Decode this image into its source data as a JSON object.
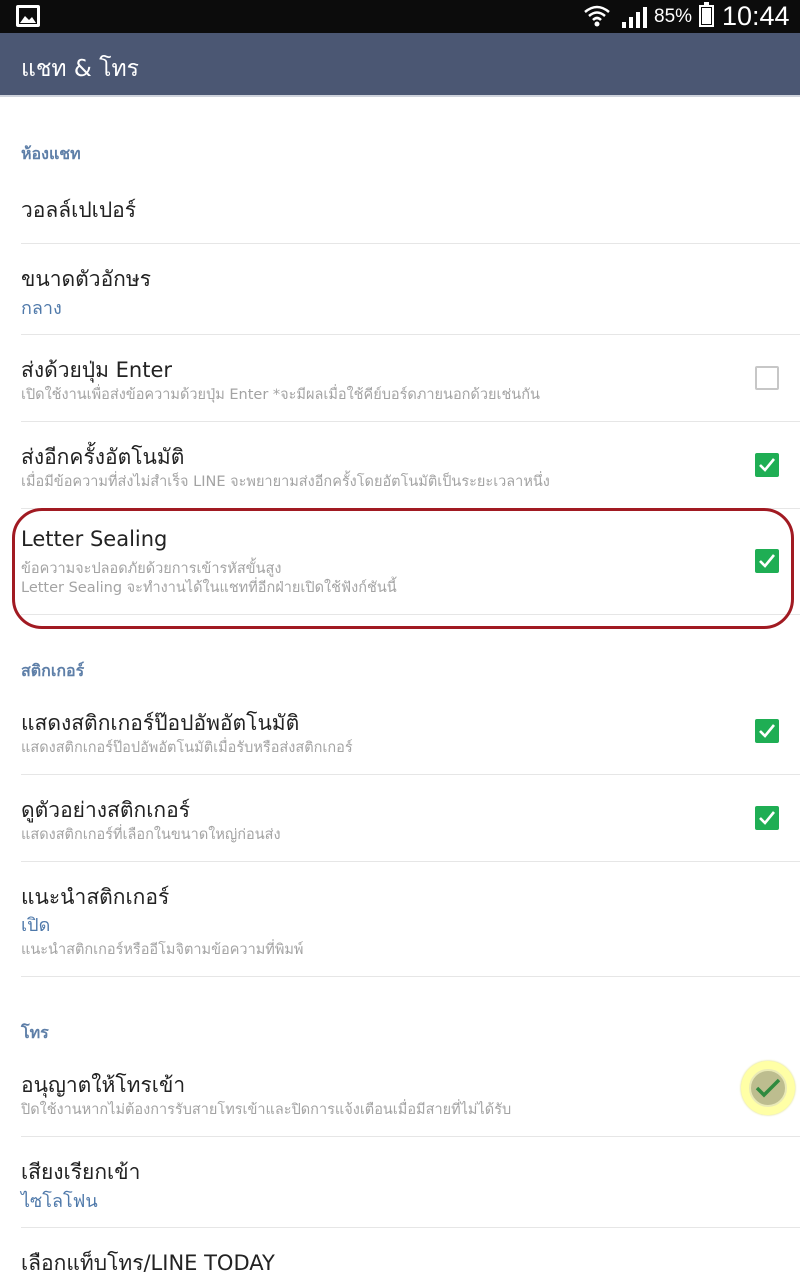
{
  "status_bar": {
    "battery_percent": "85%",
    "time": "10:44",
    "icons": [
      "gallery-icon",
      "wifi-icon",
      "signal-icon",
      "battery-icon"
    ]
  },
  "app_bar": {
    "title": "แชท & โทร"
  },
  "sections": {
    "chat": {
      "header": "ห้องแชท",
      "wallpaper": {
        "label": "วอลล์เปเปอร์"
      },
      "font_size": {
        "label": "ขนาดตัวอักษร",
        "value": "กลาง"
      },
      "enter_send": {
        "label": "ส่งด้วยปุ่ม Enter",
        "desc": "เปิดใช้งานเพื่อส่งข้อความด้วยปุ่ม Enter *จะมีผลเมื่อใช้คีย์บอร์ดภายนอกด้วยเช่นกัน",
        "checked": false
      },
      "auto_resend": {
        "label": "ส่งอีกครั้งอัตโนมัติ",
        "desc": "เมื่อมีข้อความที่ส่งไม่สำเร็จ LINE จะพยายามส่งอีกครั้งโดยอัตโนมัติเป็นระยะเวลาหนึ่ง",
        "checked": true
      },
      "letter_sealing": {
        "label": "Letter Sealing",
        "desc_line1": "ข้อความจะปลอดภัยด้วยการเข้ารหัสขั้นสูง",
        "desc_line2": "Letter Sealing จะทำงานได้ในแชทที่อีกฝ่ายเปิดใช้ฟังก์ชันนี้",
        "checked": true
      }
    },
    "sticker": {
      "header": "สติกเกอร์",
      "auto_popup": {
        "label": "แสดงสติกเกอร์ป๊อปอัพอัตโนมัติ",
        "desc": "แสดงสติกเกอร์ป๊อปอัพอัตโนมัติเมื่อรับหรือส่งสติกเกอร์",
        "checked": true
      },
      "preview": {
        "label": "ดูตัวอย่างสติกเกอร์",
        "desc": "แสดงสติกเกอร์ที่เลือกในขนาดใหญ่ก่อนส่ง",
        "checked": true
      },
      "suggest": {
        "label": "แนะนำสติกเกอร์",
        "value": "เปิด",
        "desc": "แนะนำสติกเกอร์หรืออีโมจิตามข้อความที่พิมพ์"
      }
    },
    "call": {
      "header": "โทร",
      "allow_incoming": {
        "label": "อนุญาตให้โทรเข้า",
        "desc": "ปิดใช้งานหากไม่ต้องการรับสายโทรเข้าและปิดการแจ้งเตือนเมื่อมีสายที่ไม่ได้รับ",
        "checked": true
      },
      "ringtone": {
        "label": "เสียงเรียกเข้า",
        "value": "ไซโลโฟน"
      },
      "call_tab": {
        "label": "เลือกแท็บโทร/LINE TODAY"
      }
    }
  },
  "colors": {
    "app_bar": "#4b5773",
    "section_header": "#5e7fa8",
    "value_text": "#4f79aa",
    "checkbox_on": "#1fae54",
    "highlight_ring": "#a11a22"
  }
}
